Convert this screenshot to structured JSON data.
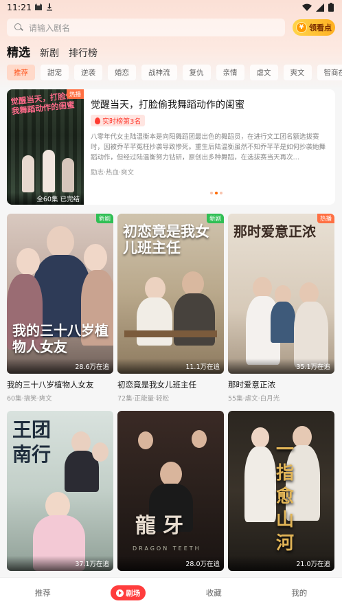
{
  "status_bar": {
    "time": "11:21",
    "icons": [
      "cat-notification-icon",
      "download-icon",
      "wifi-icon",
      "signal-icon",
      "battery-icon"
    ]
  },
  "search": {
    "placeholder": "请输入剧名"
  },
  "watch_button": {
    "label": "领看点",
    "coin_glyph": "¥"
  },
  "main_tabs": [
    {
      "label": "精选",
      "active": true
    },
    {
      "label": "新剧",
      "active": false
    },
    {
      "label": "排行榜",
      "active": false
    }
  ],
  "chips": [
    "推荐",
    "甜宠",
    "逆袭",
    "婚恋",
    "战神流",
    "复仇",
    "亲情",
    "虐文",
    "爽文",
    "智商在线"
  ],
  "featured": {
    "poster_title": "觉醒当天，打脸偷我舞蹈动作的闺蜜",
    "badge": "热播",
    "episode_info": "全60集 已完结",
    "title": "觉醒当天，打脸偷我舞蹈动作的闺蜜",
    "rank": "实时榜第3名",
    "description": "八零年代女主陆温衡本是向阳舞蹈团最出色的舞蹈员，在进行文工团名额选拔赛时，因被乔芊芊冤枉抄袭导致惨死。重生后陆温衡虽然不知乔芊芊是如何抄袭她舞蹈动作，但经过陆温衡努力钻研，原创出多种舞蹈，在选拔赛当天再次…",
    "tags": "励志·热血·爽文"
  },
  "cards": [
    {
      "cover_title": "我的三十八岁植物人女友",
      "views": "28.6万在追",
      "name": "我的三十八岁植物人女友",
      "meta": "60集·搞笑·爽文",
      "badge": "新剧"
    },
    {
      "cover_title": "初恋竟是我女儿班主任",
      "views": "11.1万在追",
      "name": "初恋竟是我女儿班主任",
      "meta": "72集·正能量·轻松",
      "badge": "新剧"
    },
    {
      "cover_title": "那时爱意正浓",
      "views": "35.1万在追",
      "name": "那时爱意正浓",
      "meta": "55集·虐文·白月光",
      "badge": "热播"
    },
    {
      "cover_title": "王团南行",
      "views": "37.1万在追",
      "name": "",
      "meta": "",
      "badge": ""
    },
    {
      "cover_title": "龍牙",
      "cover_subtitle": "DRAGON TEETH",
      "views": "28.0万在追",
      "name": "",
      "meta": "",
      "badge": ""
    },
    {
      "cover_title": "一指愈山河",
      "views": "21.0万在追",
      "name": "",
      "meta": "",
      "badge": ""
    }
  ],
  "bottom_nav": [
    {
      "label": "推荐",
      "active": false
    },
    {
      "label": "剧场",
      "active": true
    },
    {
      "label": "收藏",
      "active": false
    },
    {
      "label": "我的",
      "active": false
    }
  ],
  "colors": {
    "accent": "#ff5a24",
    "nav_active": "#ff3d3d",
    "hot_badge": "#ff7043",
    "new_badge": "#2fbf54"
  }
}
